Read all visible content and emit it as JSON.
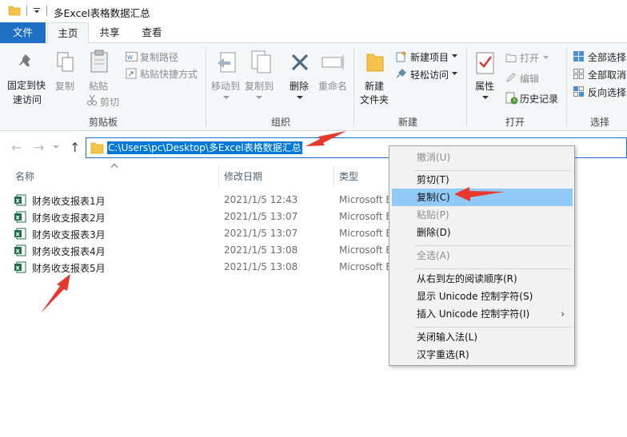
{
  "window": {
    "title": "多Excel表格数据汇总"
  },
  "tabs": [
    {
      "label": "文件"
    },
    {
      "label": "主页"
    },
    {
      "label": "共享"
    },
    {
      "label": "查看"
    }
  ],
  "ribbon": {
    "clipboard": {
      "pin_label_1": "固定到快",
      "pin_label_2": "速访问",
      "copy": "复制",
      "paste": "粘贴",
      "copy_path": "复制路径",
      "paste_shortcut": "粘贴快捷方式",
      "cut": "剪切",
      "group": "剪贴板"
    },
    "organize": {
      "move_to": "移动到",
      "copy_to": "复制到",
      "delete": "删除",
      "rename": "重命名",
      "group": "组织"
    },
    "new": {
      "new_folder_1": "新建",
      "new_folder_2": "文件夹",
      "new_item": "新建项目",
      "easy_access": "轻松访问",
      "group": "新建"
    },
    "open": {
      "properties": "属性",
      "open": "打开",
      "edit": "编辑",
      "history": "历史记录",
      "group": "打开"
    },
    "select": {
      "select_all": "全部选择",
      "select_none": "全部取消",
      "invert": "反向选择",
      "group": "选择"
    }
  },
  "address": {
    "path": "C:\\Users\\pc\\Desktop\\多Excel表格数据汇总"
  },
  "columns": {
    "name": "名称",
    "date": "修改日期",
    "type": "类型"
  },
  "files": [
    {
      "name": "财务收支报表1月",
      "date": "2021/1/5 12:43",
      "type": "Microsoft E"
    },
    {
      "name": "财务收支报表2月",
      "date": "2021/1/5 13:07",
      "type": "Microsoft E"
    },
    {
      "name": "财务收支报表3月",
      "date": "2021/1/5 13:07",
      "type": "Microsoft E"
    },
    {
      "name": "财务收支报表4月",
      "date": "2021/1/5 13:08",
      "type": "Microsoft E"
    },
    {
      "name": "财务收支报表5月",
      "date": "2021/1/5 13:08",
      "type": "Microsoft E"
    }
  ],
  "context_menu": [
    {
      "label": "撤消(U)",
      "disabled": true
    },
    {
      "label": "剪切(T)"
    },
    {
      "label": "复制(C)",
      "highlighted": true
    },
    {
      "label": "粘贴(P)",
      "disabled": true
    },
    {
      "label": "删除(D)"
    },
    {
      "label": "全选(A)",
      "disabled": true
    },
    {
      "label": "从右到左的阅读顺序(R)"
    },
    {
      "label": "显示 Unicode 控制字符(S)"
    },
    {
      "label": "插入 Unicode 控制字符(I)",
      "submenu": true
    },
    {
      "label": "关闭输入法(L)"
    },
    {
      "label": "汉字重选(R)"
    }
  ],
  "colors": {
    "file_tab": "#1e6fc5",
    "selection": "#0078d7",
    "menu_highlight": "#91c9f7",
    "annotation_arrow": "#e8372c",
    "excel_green": "#1d7044"
  }
}
